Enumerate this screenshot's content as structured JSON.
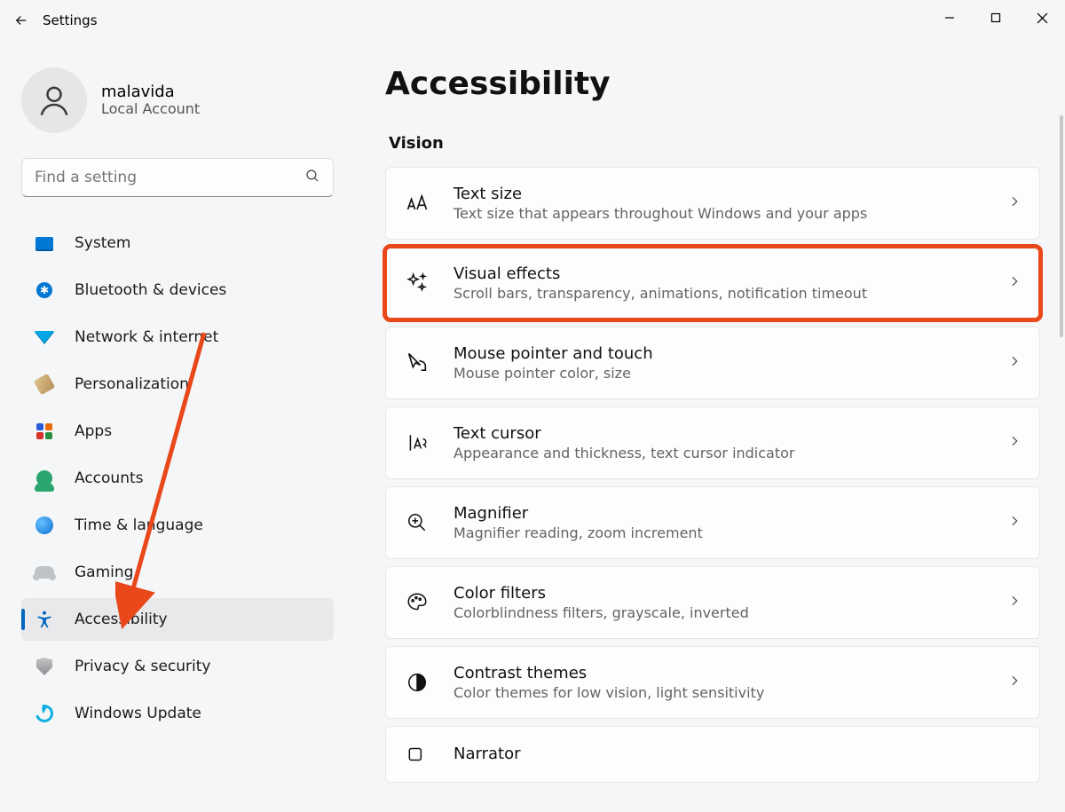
{
  "app_title": "Settings",
  "account": {
    "name": "malavida",
    "sub": "Local Account"
  },
  "search": {
    "placeholder": "Find a setting"
  },
  "sidebar": {
    "items": [
      {
        "label": "System"
      },
      {
        "label": "Bluetooth & devices"
      },
      {
        "label": "Network & internet"
      },
      {
        "label": "Personalization"
      },
      {
        "label": "Apps"
      },
      {
        "label": "Accounts"
      },
      {
        "label": "Time & language"
      },
      {
        "label": "Gaming"
      },
      {
        "label": "Accessibility"
      },
      {
        "label": "Privacy & security"
      },
      {
        "label": "Windows Update"
      }
    ]
  },
  "main": {
    "title": "Accessibility",
    "section": "Vision",
    "cards": [
      {
        "title": "Text size",
        "desc": "Text size that appears throughout Windows and your apps"
      },
      {
        "title": "Visual effects",
        "desc": "Scroll bars, transparency, animations, notification timeout"
      },
      {
        "title": "Mouse pointer and touch",
        "desc": "Mouse pointer color, size"
      },
      {
        "title": "Text cursor",
        "desc": "Appearance and thickness, text cursor indicator"
      },
      {
        "title": "Magnifier",
        "desc": "Magnifier reading, zoom increment"
      },
      {
        "title": "Color filters",
        "desc": "Colorblindness filters, grayscale, inverted"
      },
      {
        "title": "Contrast themes",
        "desc": "Color themes for low vision, light sensitivity"
      },
      {
        "title": "Narrator",
        "desc": ""
      }
    ]
  }
}
